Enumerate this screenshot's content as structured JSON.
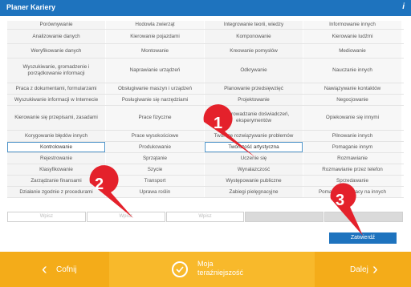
{
  "window": {
    "title": "Planer Kariery",
    "info_icon": "i"
  },
  "grid": [
    {
      "h": 10,
      "cells": [
        "Porównywanie",
        "Hodowla zwierząt",
        "Integrowanie teorii, wiedzy",
        "Informowanie innych"
      ]
    },
    {
      "h": 17,
      "cells": [
        "Analizowanie danych",
        "Kierowanie pojazdami",
        "Komponowanie",
        "Kierowanie ludźmi"
      ]
    },
    {
      "h": 17,
      "cells": [
        "Weryfikowanie danych",
        "Montowanie",
        "Kreowanie pomysłów",
        "Mediowanie"
      ]
    },
    {
      "h": 30,
      "cells": [
        "Wyszukiwanie, gromadzenie i porządkowanie informacji",
        "Naprawianie urządzeń",
        "Odkrywanie",
        "Nauczanie innych"
      ]
    },
    {
      "h": 13,
      "cells": [
        "Praca z dokumentami, formularzami",
        "Obsługiwanie maszyn i urządzeń",
        "Planowanie przedsięwzięć",
        "Nawiązywanie kontaktów"
      ]
    },
    {
      "h": 13,
      "cells": [
        "Wyszukiwanie informacji w Internecie",
        "Posługiwanie się narzędziami",
        "Projektowanie",
        "Negocjowanie"
      ]
    },
    {
      "h": 30,
      "cells": [
        "Kierowanie się przepisami, zasadami",
        "Prace fizyczne",
        "Przeprowadzanie doświadczeń, eksperymentów",
        "Opiekowanie się innymi"
      ]
    },
    {
      "h": 13,
      "cells": [
        "Korygowanie błędów innych",
        "Prace wysokościowe",
        "Twórcze rozwiązywanie problemów",
        "Pilnowanie innych"
      ]
    },
    {
      "h": 13,
      "cells": [
        "Kontrolowanie",
        "Produkowanie",
        "Twórczość artystyczna",
        "Pomaganie innym"
      ]
    },
    {
      "h": 13,
      "cells": [
        "Rejestrowanie",
        "Sprzątanie",
        "Uczenie się",
        "Rozmawianie"
      ]
    },
    {
      "h": 13,
      "cells": [
        "Klasyfikowanie",
        "Szycie",
        "Wynalazczość",
        "Rozmawianie przez telefon"
      ]
    },
    {
      "h": 13,
      "cells": [
        "Zarządzanie finansami",
        "Transport",
        "Występowanie publiczne",
        "Sprzedawanie"
      ]
    },
    {
      "h": 13,
      "cells": [
        "Działanie zgodnie z procedurami",
        "Uprawa roślin",
        "Zabiegi pielęgnacyjne",
        "Pomaganie w pracy na innych"
      ]
    }
  ],
  "selected": {
    "0": 8,
    "2": 8
  },
  "inputs": [
    {
      "placeholder": "Wpisz"
    },
    {
      "placeholder": "Wpisz"
    },
    {
      "placeholder": "Wpisz"
    },
    {
      "placeholder": ""
    },
    {
      "placeholder": ""
    }
  ],
  "confirm_label": "Zatwierdź",
  "nav": {
    "back_label": "Cofnij",
    "center_line1": "Moja",
    "center_line2": "teraźniejszość",
    "next_label": "Dalej"
  },
  "markers": [
    "1",
    "2",
    "3"
  ],
  "colors": {
    "header": "#1e73be",
    "accent": "#f8b92b",
    "marker": "#e4212b"
  }
}
